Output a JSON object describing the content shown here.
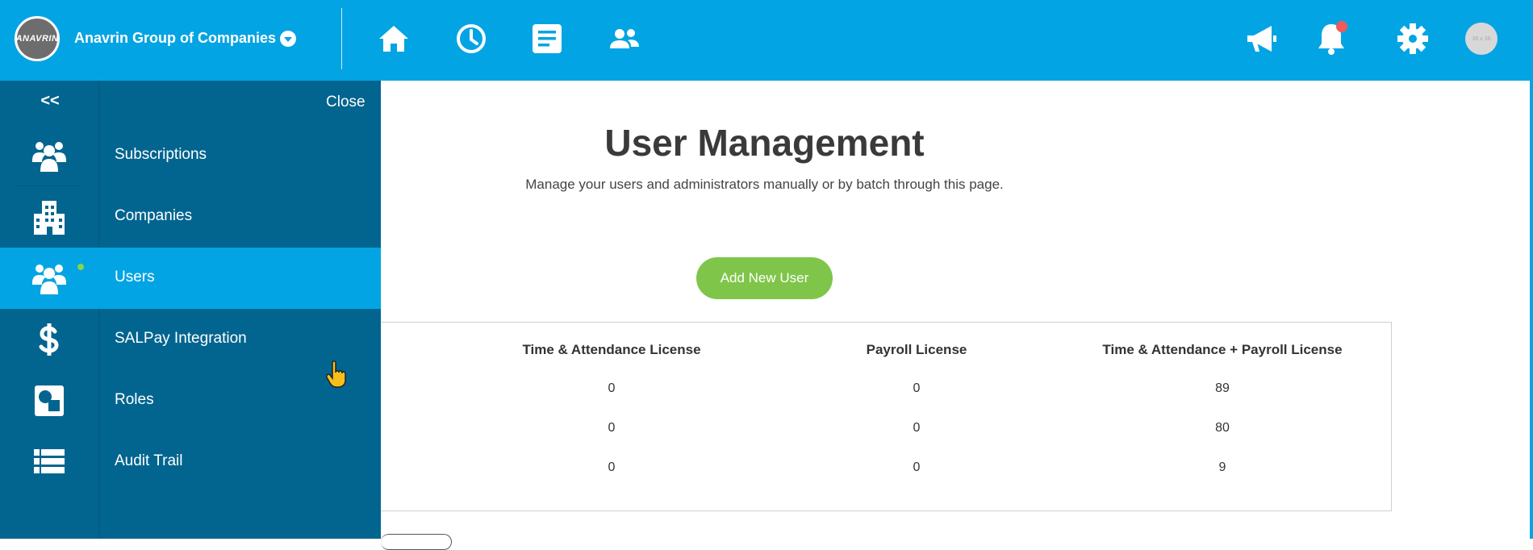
{
  "topbar": {
    "logo_text": "ANAVRIN",
    "company_name": "Anavrin Group of Companies",
    "nav_icons": [
      "home-icon",
      "clock-icon",
      "document-icon",
      "people-icon"
    ],
    "right_icons": [
      "megaphone-icon",
      "bell-icon",
      "gear-icon"
    ],
    "avatar_text": "38 x 38"
  },
  "sidebar": {
    "collapse_label": "<<",
    "close_label": "Close",
    "items": [
      {
        "label": "Subscriptions",
        "icon": "users-group-icon"
      },
      {
        "label": "Companies",
        "icon": "building-icon"
      },
      {
        "label": "Users",
        "icon": "users-group-icon",
        "active": true
      },
      {
        "label": "SALPay Integration",
        "icon": "dollar-icon"
      },
      {
        "label": "Roles",
        "icon": "roles-icon"
      },
      {
        "label": "Audit Trail",
        "icon": "list-icon"
      }
    ]
  },
  "main": {
    "title": "User Management",
    "subtitle": "Manage your users and administrators manually or by batch through this page.",
    "add_button": "Add New User",
    "licenses": {
      "headers": [
        "Time & Attendance License",
        "Payroll License",
        "Time & Attendance + Payroll License"
      ],
      "rows": [
        [
          "0",
          "0",
          "89"
        ],
        [
          "0",
          "0",
          "80"
        ],
        [
          "0",
          "0",
          "9"
        ]
      ]
    }
  },
  "colors": {
    "primary": "#03a4e3",
    "sidebar": "#02658f",
    "button_green": "#7fc54a",
    "notification": "#f05a5a"
  }
}
